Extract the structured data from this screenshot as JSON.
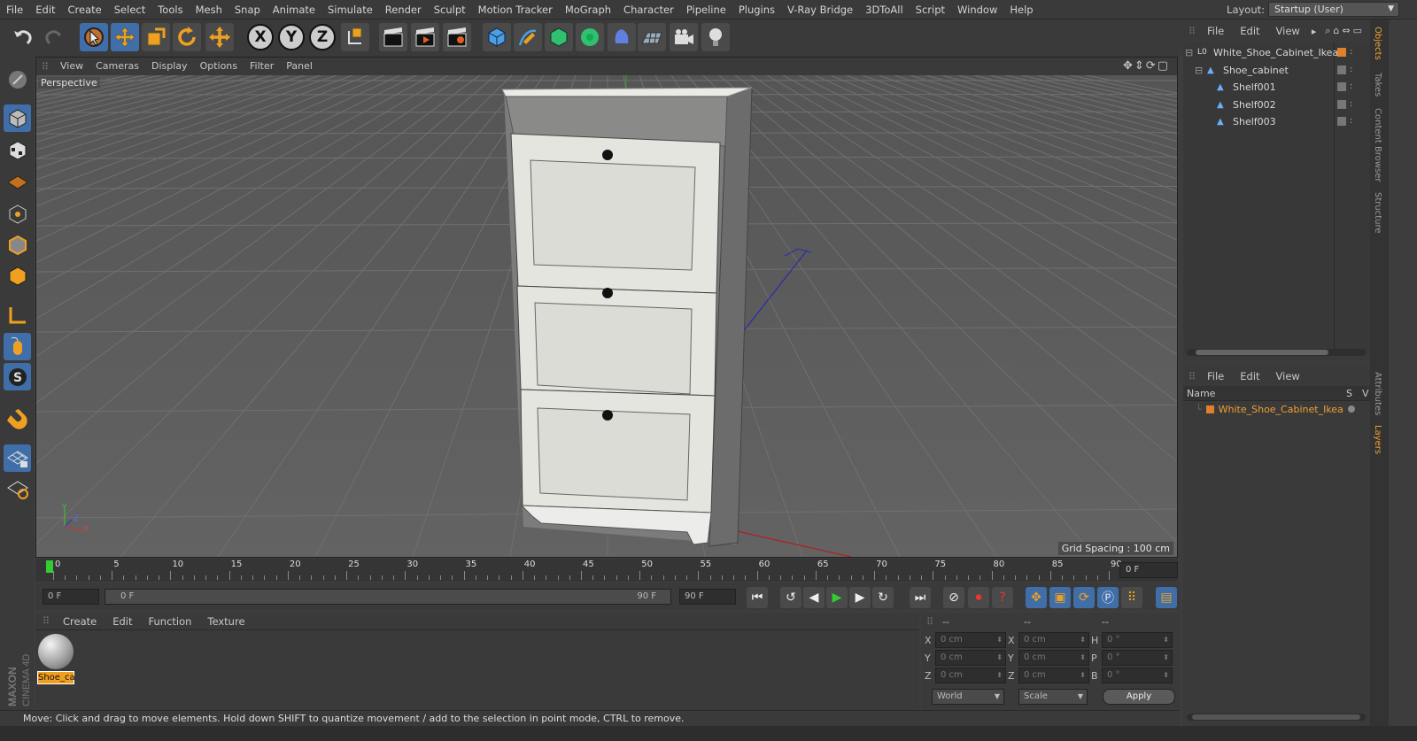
{
  "menubar": {
    "items": [
      "File",
      "Edit",
      "Create",
      "Select",
      "Tools",
      "Mesh",
      "Snap",
      "Animate",
      "Simulate",
      "Render",
      "Sculpt",
      "Motion Tracker",
      "MoGraph",
      "Character",
      "Pipeline",
      "Plugins",
      "V-Ray Bridge",
      "3DToAll",
      "Script",
      "Window",
      "Help"
    ],
    "layout_label": "Layout:",
    "layout_value": "Startup (User)"
  },
  "toolbar": {
    "axis_x": "X",
    "axis_y": "Y",
    "axis_z": "Z"
  },
  "viewport": {
    "menu": [
      "View",
      "Cameras",
      "Display",
      "Options",
      "Filter",
      "Panel"
    ],
    "label": "Perspective",
    "grid_spacing": "Grid Spacing : 100 cm",
    "axis_y": "Y",
    "axis_z": "Z",
    "axis_x": "X"
  },
  "timeline": {
    "ticks": [
      "0",
      "5",
      "10",
      "15",
      "20",
      "25",
      "30",
      "35",
      "40",
      "45",
      "50",
      "55",
      "60",
      "65",
      "70",
      "75",
      "80",
      "85",
      "90"
    ],
    "current_frame": "0 F"
  },
  "transport": {
    "start_field": "0 F",
    "range_start": "0 F",
    "range_end": "90 F",
    "end_field": "90 F"
  },
  "material_panel": {
    "menu": [
      "Create",
      "Edit",
      "Function",
      "Texture"
    ],
    "material_name": "Shoe_ca"
  },
  "coord_panel": {
    "col1": "--",
    "col2": "--",
    "col3": "--",
    "labels_pos": [
      "X",
      "Y",
      "Z"
    ],
    "labels_size": [
      "X",
      "Y",
      "Z"
    ],
    "labels_rot": [
      "H",
      "P",
      "B"
    ],
    "pos_values": [
      "0 cm",
      "0 cm",
      "0 cm"
    ],
    "size_values": [
      "0 cm",
      "0 cm",
      "0 cm"
    ],
    "rot_values": [
      "0 °",
      "0 °",
      "0 °"
    ],
    "mode1": "World",
    "mode2": "Scale",
    "apply": "Apply"
  },
  "status": "Move: Click and drag to move elements. Hold down SHIFT to quantize movement / add to the selection in point mode, CTRL to remove.",
  "objects_panel": {
    "menu": [
      "File",
      "Edit",
      "View"
    ],
    "items": [
      {
        "name": "White_Shoe_Cabinet_Ikea",
        "indent": 0
      },
      {
        "name": "Shoe_cabinet",
        "indent": 1
      },
      {
        "name": "Shelf001",
        "indent": 2
      },
      {
        "name": "Shelf002",
        "indent": 2
      },
      {
        "name": "Shelf003",
        "indent": 2
      }
    ]
  },
  "layers_panel": {
    "menu": [
      "File",
      "Edit",
      "View"
    ],
    "col_name": "Name",
    "col_s": "S",
    "col_v": "V",
    "item": "White_Shoe_Cabinet_Ikea"
  },
  "side_tabs": [
    "Objects",
    "Takes",
    "Content Browser",
    "Structure",
    "Attributes",
    "Layers"
  ],
  "logo": {
    "line1": "MAXON",
    "line2": "CINEMA 4D"
  },
  "colors": {
    "accent": "#3f6ea9",
    "orange": "#e0802c",
    "selected_text": "#f0a030"
  }
}
